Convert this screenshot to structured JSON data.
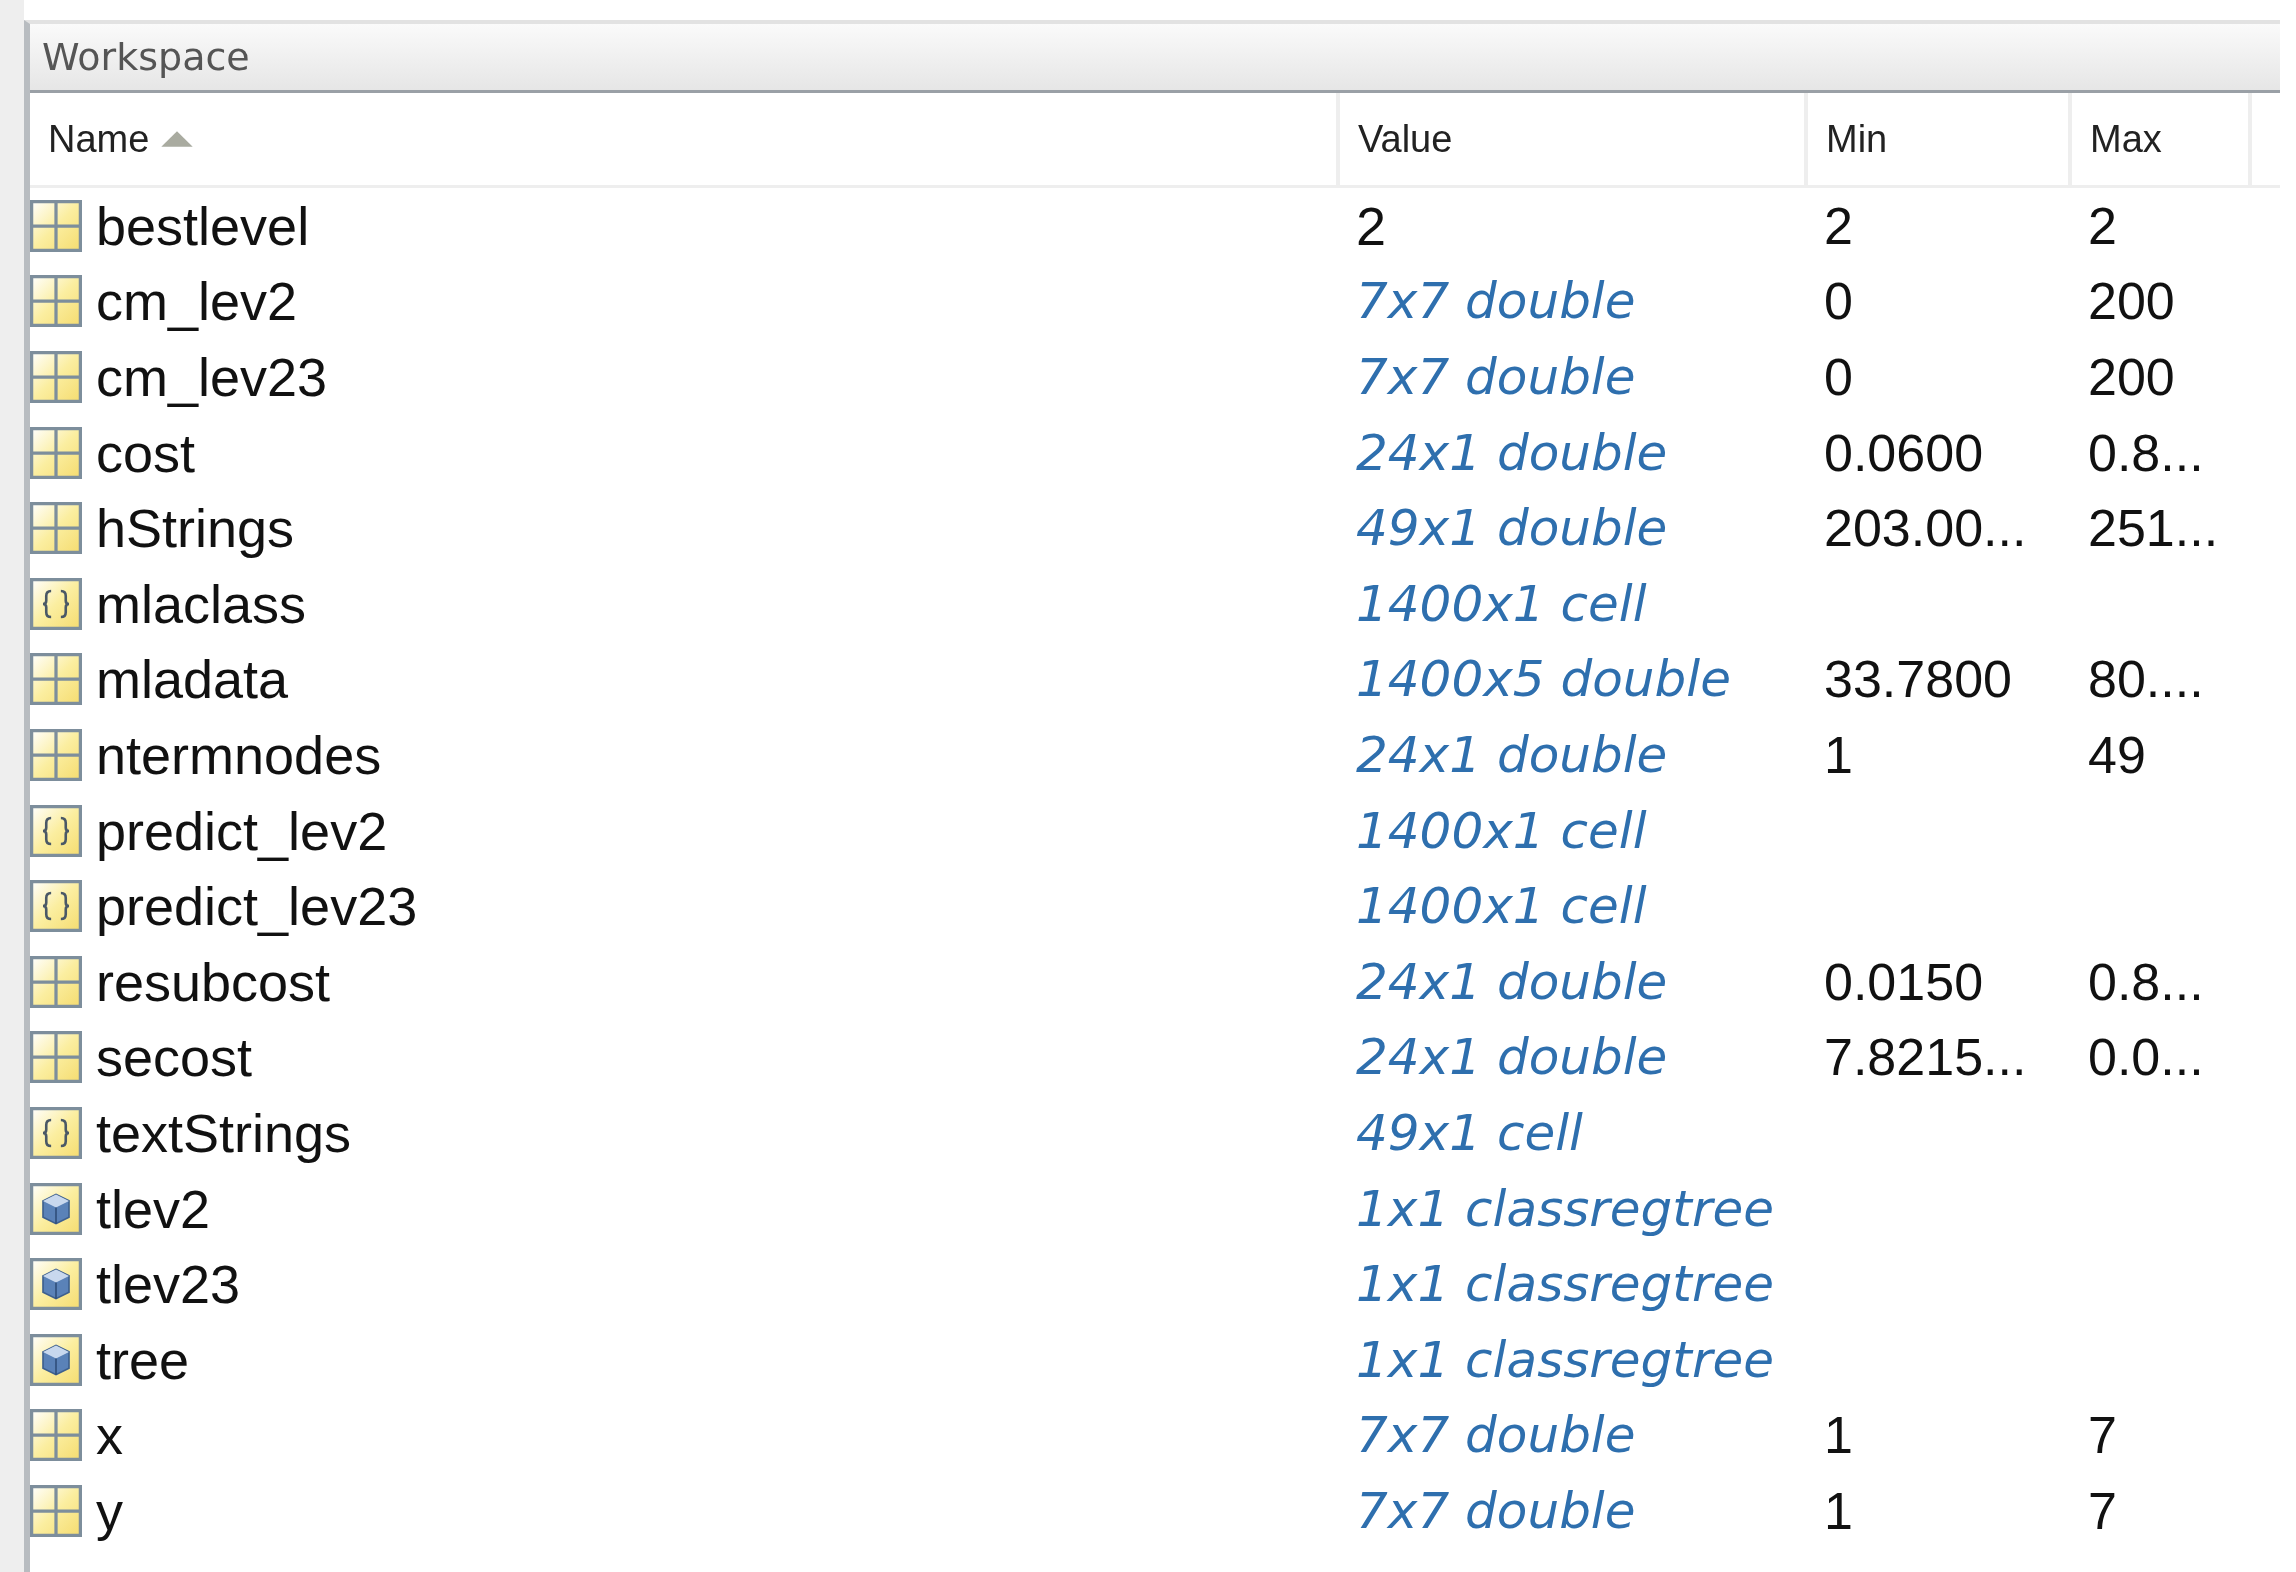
{
  "panel": {
    "title": "Workspace"
  },
  "table": {
    "columns": [
      {
        "label": "Name",
        "sorted_ascending": true
      },
      {
        "label": "Value"
      },
      {
        "label": "Min"
      },
      {
        "label": "Max"
      }
    ],
    "rows": [
      {
        "kind": "scalar",
        "name": "bestlevel",
        "value": "2",
        "min": "2",
        "max": "2"
      },
      {
        "kind": "matrix",
        "name": "cm_lev2",
        "value": "7x7 double",
        "min": "0",
        "max": "200"
      },
      {
        "kind": "matrix",
        "name": "cm_lev23",
        "value": "7x7 double",
        "min": "0",
        "max": "200"
      },
      {
        "kind": "matrix",
        "name": "cost",
        "value": "24x1 double",
        "min": "0.0600",
        "max": "0.8..."
      },
      {
        "kind": "matrix",
        "name": "hStrings",
        "value": "49x1 double",
        "min": "203.00...",
        "max": "251..."
      },
      {
        "kind": "cell",
        "name": "mlaclass",
        "value": "1400x1 cell"
      },
      {
        "kind": "matrix",
        "name": "mladata",
        "value": "1400x5 double",
        "min": "33.7800",
        "max": "80...."
      },
      {
        "kind": "matrix",
        "name": "ntermnodes",
        "value": "24x1 double",
        "min": "1",
        "max": "49"
      },
      {
        "kind": "cell",
        "name": "predict_lev2",
        "value": "1400x1 cell"
      },
      {
        "kind": "cell",
        "name": "predict_lev23",
        "value": "1400x1 cell"
      },
      {
        "kind": "matrix",
        "name": "resubcost",
        "value": "24x1 double",
        "min": "0.0150",
        "max": "0.8..."
      },
      {
        "kind": "matrix",
        "name": "secost",
        "value": "24x1 double",
        "min": "7.8215...",
        "max": "0.0..."
      },
      {
        "kind": "cell",
        "name": "textStrings",
        "value": "49x1 cell"
      },
      {
        "kind": "object",
        "name": "tlev2",
        "value": "1x1 classregtree"
      },
      {
        "kind": "object",
        "name": "tlev23",
        "value": "1x1 classregtree"
      },
      {
        "kind": "object",
        "name": "tree",
        "value": "1x1 classregtree"
      },
      {
        "kind": "matrix",
        "name": "x",
        "value": "7x7 double",
        "min": "1",
        "max": "7"
      },
      {
        "kind": "matrix",
        "name": "y",
        "value": "7x7 double",
        "min": "1",
        "max": "7"
      }
    ]
  }
}
